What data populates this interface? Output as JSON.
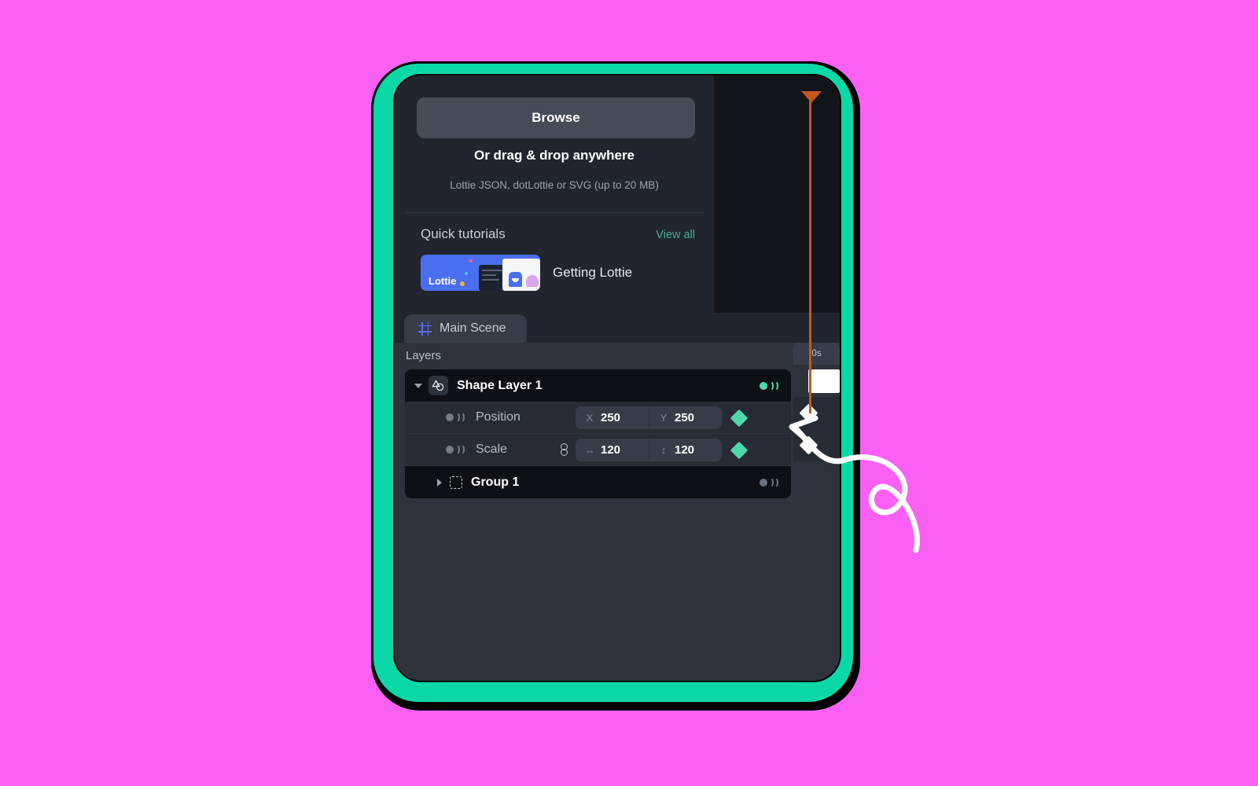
{
  "app": {
    "accent_teal": "#0bd8a7",
    "background_magenta": "#fb60f5",
    "panel_bg": "#21262e",
    "timeline_bg": "#2e333b",
    "keyframe_green": "#4fd8ae",
    "playhead_orange": "#c2571f"
  },
  "import_panel": {
    "browse_label": "Browse",
    "drag_drop_label": "Or drag & drop anywhere",
    "formats_hint": "Lottie JSON, dotLottie or SVG (up to 20 MB)"
  },
  "tutorials": {
    "section_title": "Quick tutorials",
    "view_all_label": "View all",
    "items": [
      {
        "thumb_label": "Lottie",
        "title": "Getting Lottie"
      }
    ]
  },
  "scene_tabs": [
    {
      "label": "Main Scene",
      "icon": "frame-icon",
      "active": true
    }
  ],
  "timeline": {
    "layers_label": "Layers",
    "ruler_marker": "0s",
    "rows": [
      {
        "type": "layer",
        "name": "Shape Layer 1",
        "icon": "shape-layer-icon",
        "expanded": true,
        "animate_state": "green"
      },
      {
        "type": "property",
        "name": "Position",
        "fields": [
          {
            "axis": "X",
            "value": "250"
          },
          {
            "axis": "Y",
            "value": "250"
          }
        ],
        "linked": false,
        "keyframe": true
      },
      {
        "type": "property",
        "name": "Scale",
        "fields": [
          {
            "axis": "↔",
            "value": "120"
          },
          {
            "axis": "↕",
            "value": "120"
          }
        ],
        "linked": true,
        "keyframe": true
      },
      {
        "type": "group",
        "name": "Group 1",
        "icon": "group-icon",
        "expanded": false,
        "animate_state": "dim"
      }
    ]
  }
}
